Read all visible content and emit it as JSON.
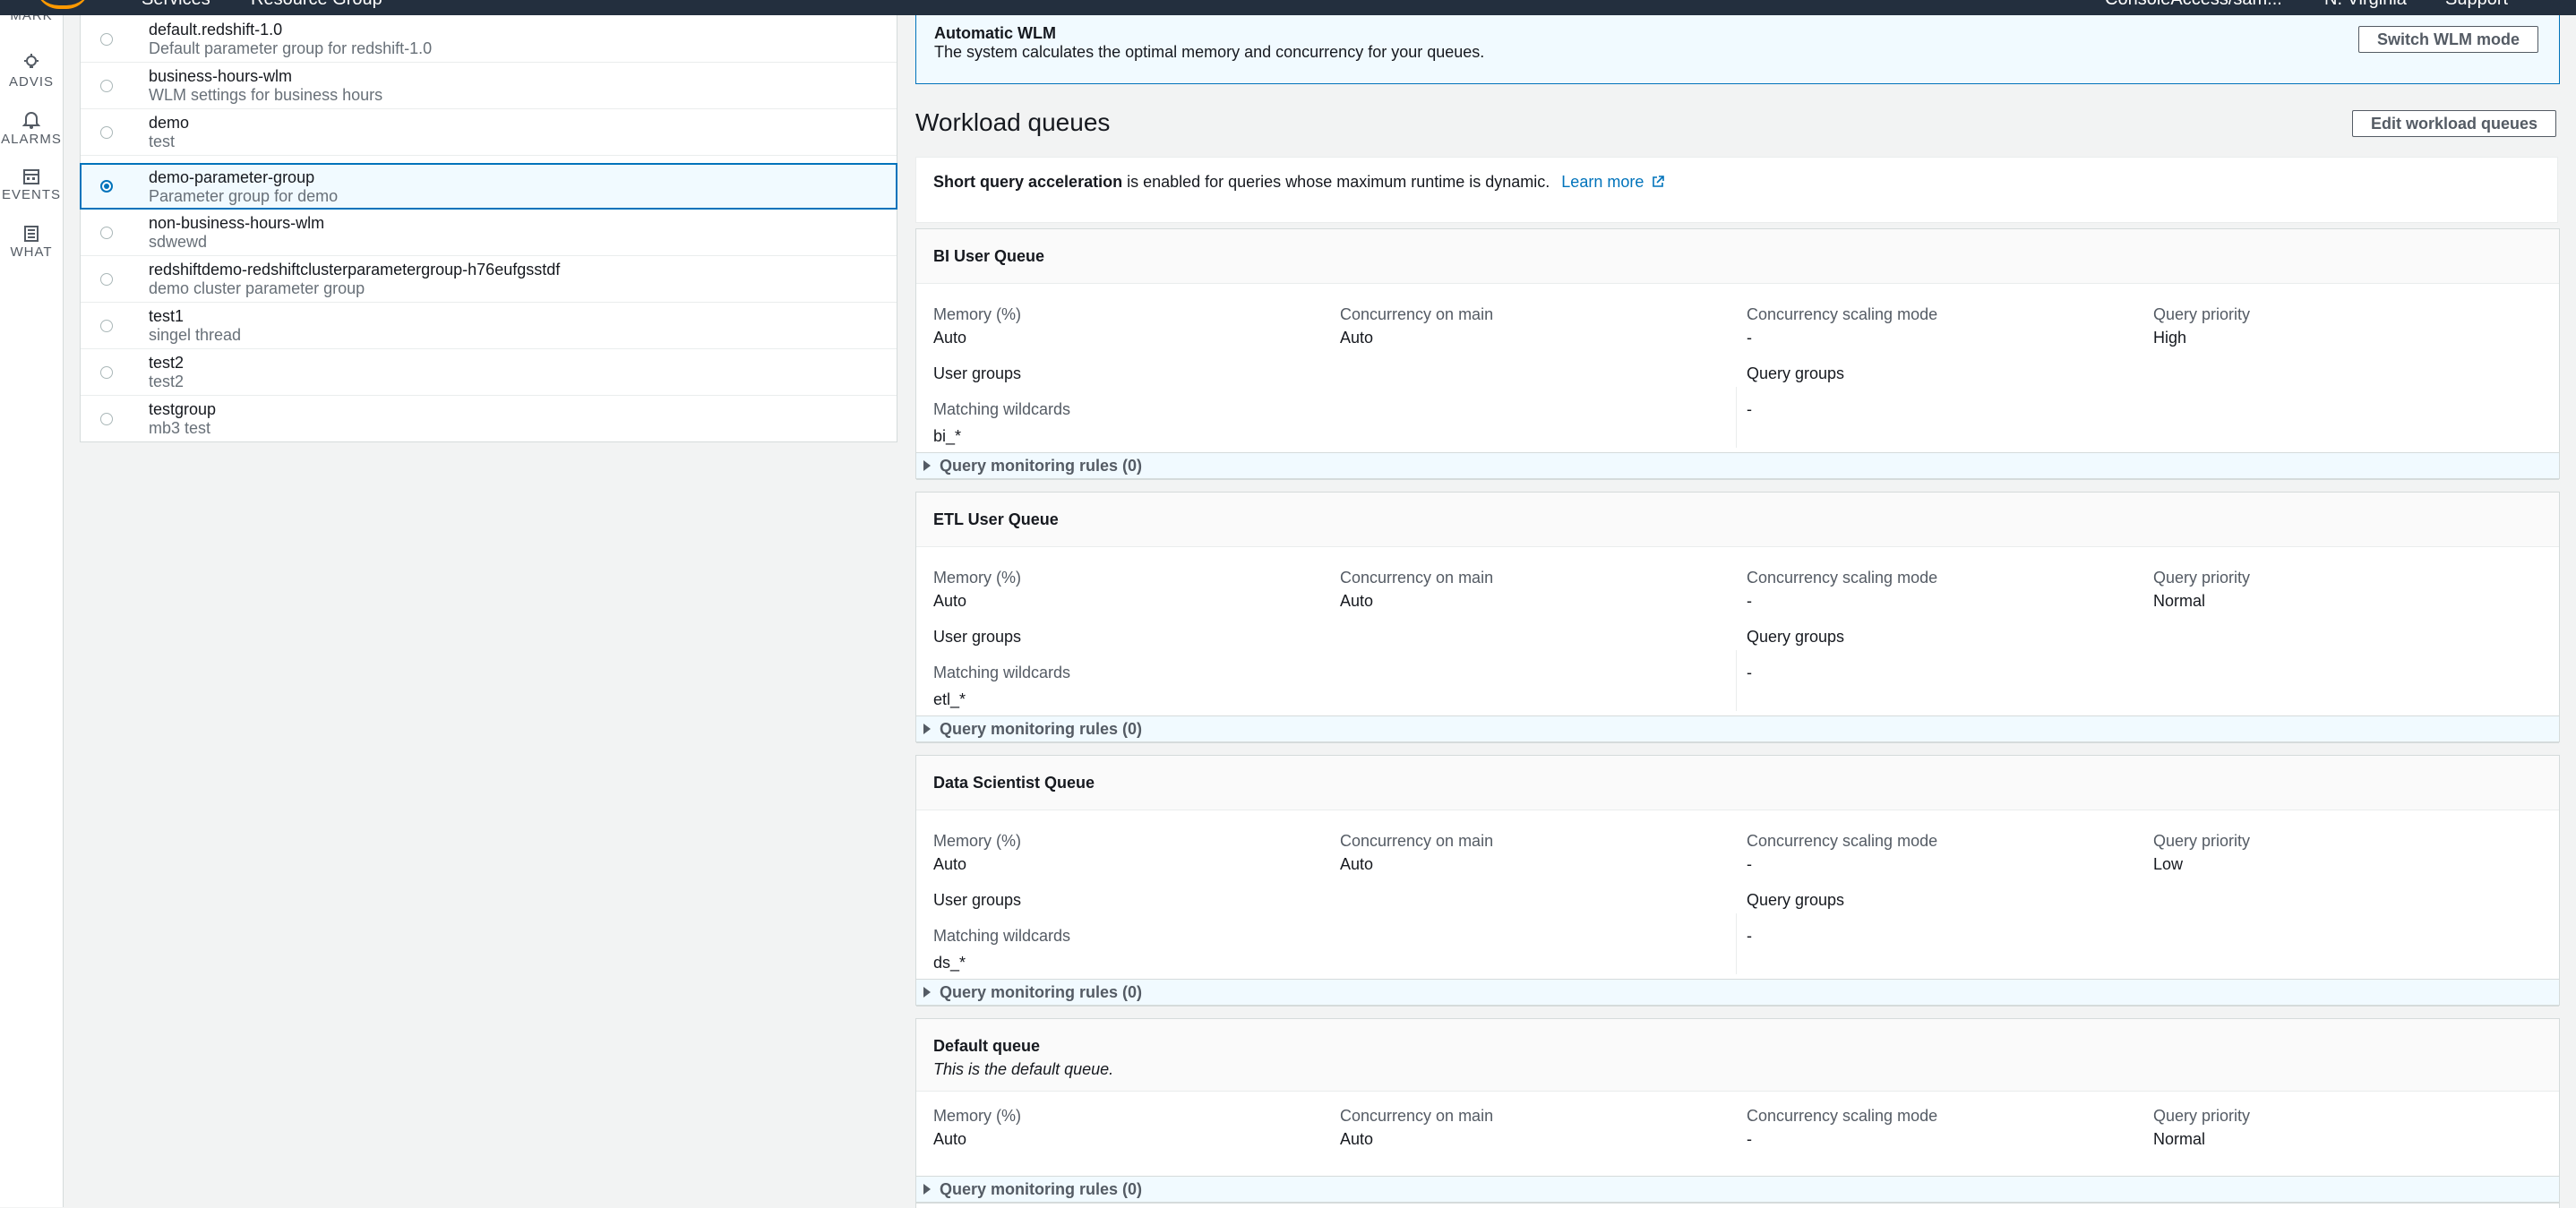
{
  "topbar": {
    "services": "Services",
    "resource_groups": "Resource Group",
    "account": "ConsoleAccess/sam...",
    "region": "N. Virginia",
    "support": "Support"
  },
  "sidenav": {
    "items": [
      {
        "label": "MARK",
        "icon": "bookmark-icon"
      },
      {
        "label": "ADVIS",
        "icon": "lightbulb-icon"
      },
      {
        "label": "ALARMS",
        "icon": "bell-icon"
      },
      {
        "label": "EVENTS",
        "icon": "calendar-icon"
      },
      {
        "label": "WHAT",
        "icon": "newspaper-icon"
      }
    ]
  },
  "parameter_groups": [
    {
      "name": "default.redshift-1.0",
      "description": "Default parameter group for redshift-1.0",
      "selected": false
    },
    {
      "name": "business-hours-wlm",
      "description": "WLM settings for business hours",
      "selected": false
    },
    {
      "name": "demo",
      "description": "test",
      "selected": false
    },
    {
      "name": "demo-parameter-group",
      "description": "Parameter group for demo",
      "selected": true
    },
    {
      "name": "non-business-hours-wlm",
      "description": "sdwewd",
      "selected": false
    },
    {
      "name": "redshiftdemo-redshiftclusterparametergroup-h76eufgsstdf",
      "description": "demo cluster parameter group",
      "selected": false
    },
    {
      "name": "test1",
      "description": "singel thread",
      "selected": false
    },
    {
      "name": "test2",
      "description": "test2",
      "selected": false
    },
    {
      "name": "testgroup",
      "description": "mb3 test",
      "selected": false
    }
  ],
  "wlm_banner": {
    "title": "Automatic WLM",
    "text": "The system calculates the optimal memory and concurrency for your queues.",
    "button": "Switch WLM mode"
  },
  "workload": {
    "heading": "Workload queues",
    "edit_button": "Edit workload queues",
    "sqa_bold": "Short query acceleration",
    "sqa_text": " is enabled for queries whose maximum runtime is dynamic.",
    "learn_more": "Learn more"
  },
  "labels": {
    "memory": "Memory (%)",
    "concurrency": "Concurrency on main",
    "scaling": "Concurrency scaling mode",
    "priority": "Query priority",
    "user_groups": "User groups",
    "query_groups": "Query groups",
    "matching_wildcards": "Matching wildcards",
    "qmr": "Query monitoring rules (0)"
  },
  "queues": [
    {
      "title": "BI User Queue",
      "memory": "Auto",
      "concurrency": "Auto",
      "scaling": "-",
      "priority": "High",
      "wildcard": "bi_*",
      "query_groups_value": "-"
    },
    {
      "title": "ETL User Queue",
      "memory": "Auto",
      "concurrency": "Auto",
      "scaling": "-",
      "priority": "Normal",
      "wildcard": "etl_*",
      "query_groups_value": "-"
    },
    {
      "title": "Data Scientist Queue",
      "memory": "Auto",
      "concurrency": "Auto",
      "scaling": "-",
      "priority": "Low",
      "wildcard": "ds_*",
      "query_groups_value": "-"
    }
  ],
  "default_queue": {
    "title": "Default queue",
    "subtitle": "This is the default queue.",
    "memory": "Auto",
    "concurrency": "Auto",
    "scaling": "-",
    "priority": "Normal"
  }
}
